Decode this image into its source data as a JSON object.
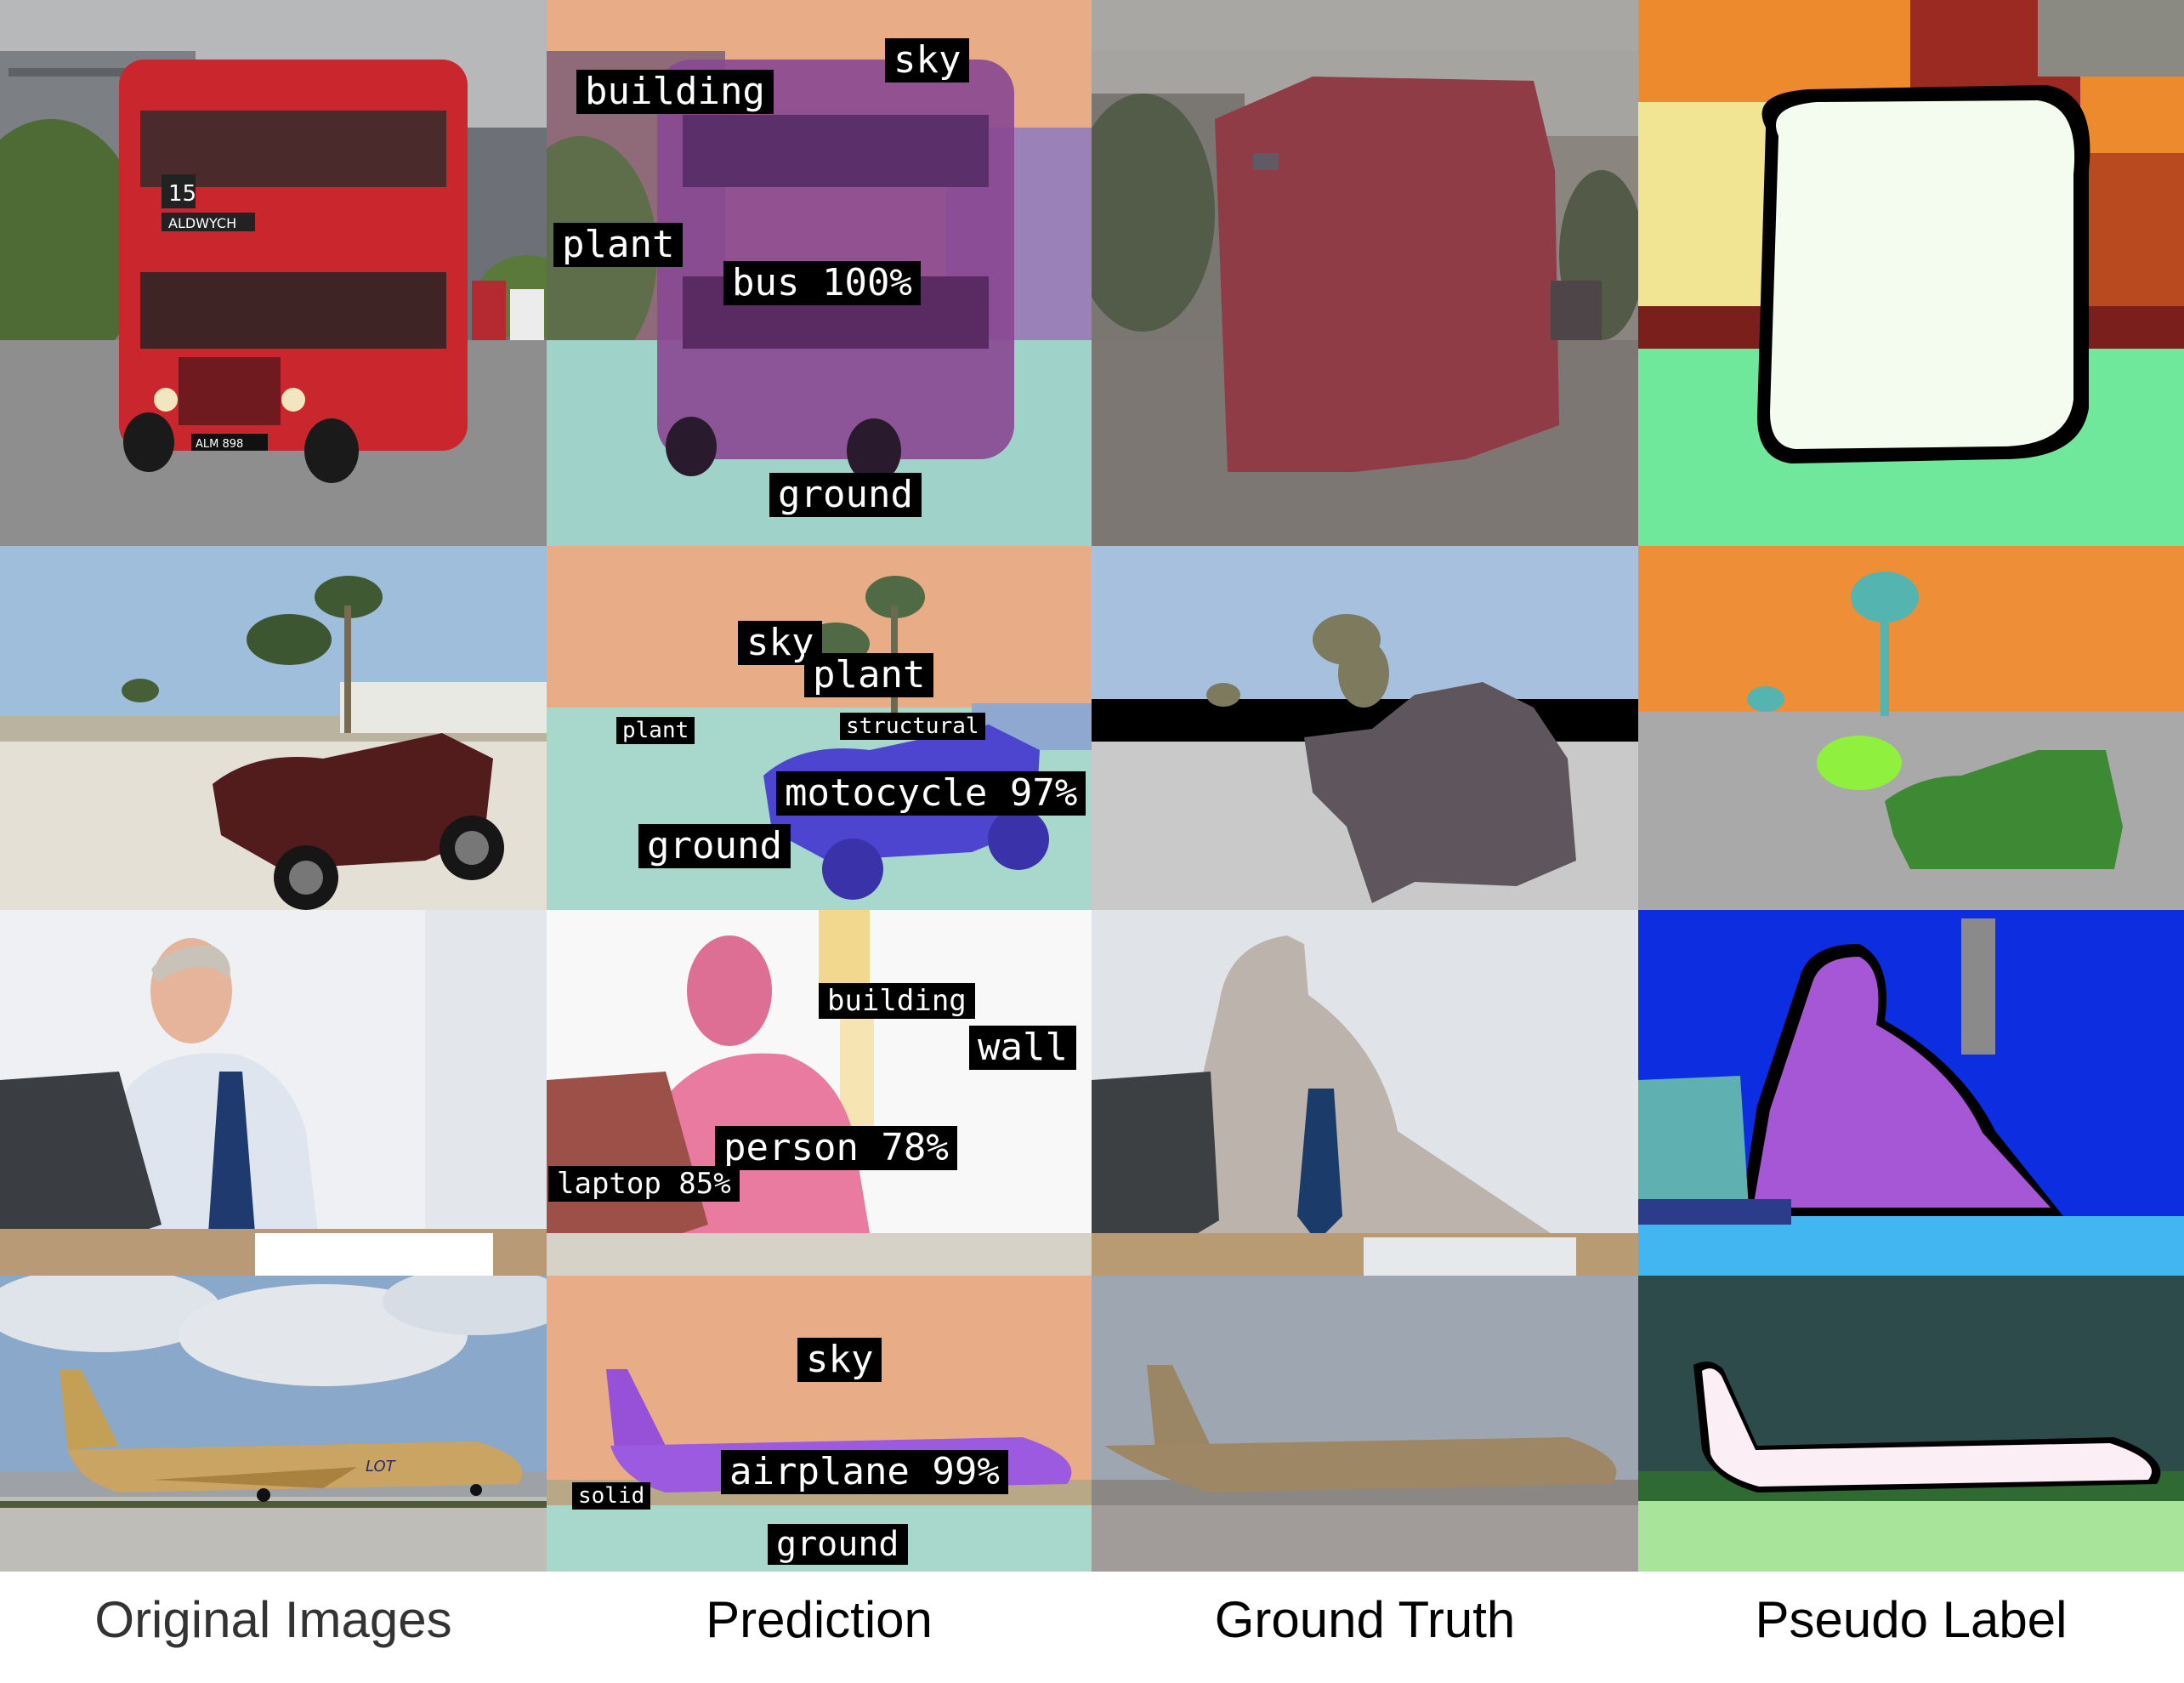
{
  "figure": {
    "columns": [
      {
        "caption": "Original Images"
      },
      {
        "caption": "Prediction"
      },
      {
        "caption": "Ground Truth"
      },
      {
        "caption": "Pseudo Label"
      }
    ],
    "rows": [
      {
        "subject": "bus",
        "prediction_labels": {
          "building": "building",
          "sky": "sky",
          "plant": "plant",
          "thing": "bus 100%",
          "ground": "ground"
        },
        "bus_route": "15",
        "bus_destination": "ALDWYCH",
        "bus_plate": "ALM 898"
      },
      {
        "subject": "motorcycle",
        "prediction_labels": {
          "sky": "sky",
          "plant": "plant",
          "plant_small": "plant",
          "structural": "structural",
          "thing": "motocycle 97%",
          "ground": "ground"
        }
      },
      {
        "subject": "person",
        "prediction_labels": {
          "building": "building",
          "wall": "wall",
          "person": "person 78%",
          "laptop": "laptop 85%"
        }
      },
      {
        "subject": "airplane",
        "prediction_labels": {
          "sky": "sky",
          "thing": "airplane 99%",
          "solid": "solid",
          "ground": "ground"
        },
        "airline_logo": "LOT"
      }
    ]
  }
}
